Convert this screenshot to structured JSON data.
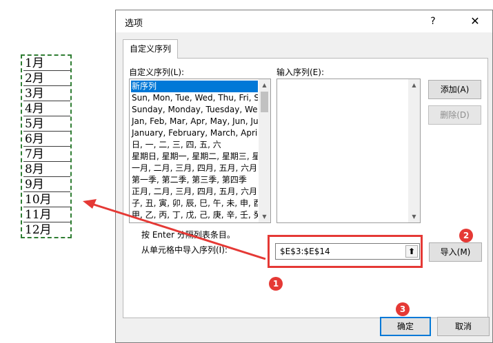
{
  "sheet": {
    "months": [
      "1月",
      "2月",
      "3月",
      "4月",
      "5月",
      "6月",
      "7月",
      "8月",
      "9月",
      "10月",
      "11月",
      "12月"
    ]
  },
  "dialog": {
    "title": "选项",
    "help_glyph": "?",
    "close_glyph": "✕",
    "tab_label": "自定义序列",
    "custom_lists_label": "自定义序列(L):",
    "input_list_label": "输入序列(E):",
    "custom_lists": [
      "新序列",
      "Sun, Mon, Tue, Wed, Thu, Fri, Sat",
      "Sunday, Monday, Tuesday, Wednesday",
      "Jan, Feb, Mar, Apr, May, Jun, Jul",
      "January, February, March, April",
      "日, 一, 二, 三, 四, 五, 六",
      "星期日, 星期一, 星期二, 星期三, 星期四",
      "一月, 二月, 三月, 四月, 五月, 六月, 七月",
      "第一季, 第二季, 第三季, 第四季",
      "正月, 二月, 三月, 四月, 五月, 六月, 七月",
      "子, 丑, 寅, 卯, 辰, 巳, 午, 未, 申, 酉",
      "甲, 乙, 丙, 丁, 戊, 己, 庚, 辛, 壬, 癸"
    ],
    "selected_index": 0,
    "add_button": "添加(A)",
    "delete_button": "删除(D)",
    "hint_text": "按 Enter 分隔列表条目。",
    "import_label": "从单元格中导入序列(I):",
    "import_range_value": "$E$3:$E$14",
    "collapse_glyph": "⬆",
    "import_button": "导入(M)",
    "ok_button": "确定",
    "cancel_button": "取消"
  },
  "annotations": {
    "badge1": "1",
    "badge2": "2",
    "badge3": "3",
    "accent_color": "#e53935",
    "highlight_color": "#2e7d32"
  }
}
